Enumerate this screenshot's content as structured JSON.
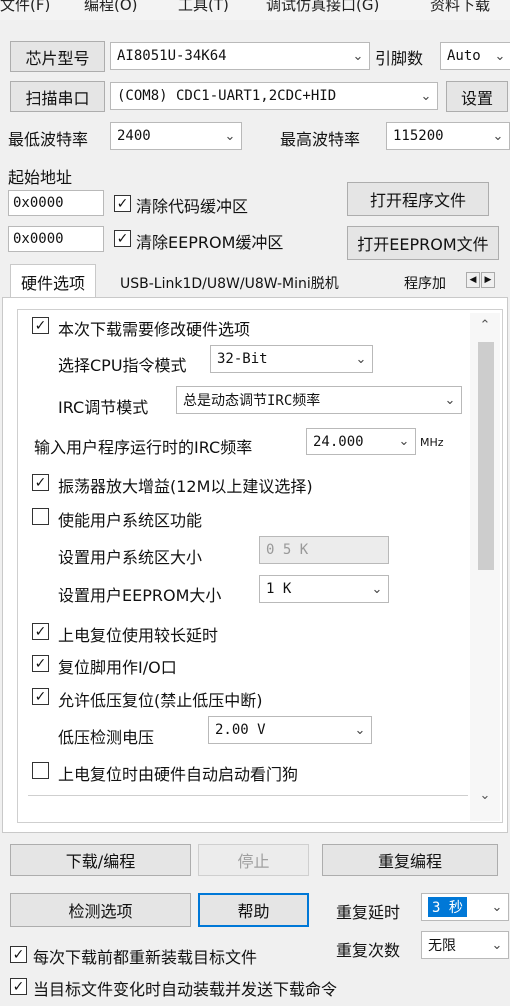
{
  "menu": [
    "文件(F)",
    "编程(O)",
    "工具(T)",
    "调试仿真接口(G)",
    "资料下载"
  ],
  "chip": {
    "button": "芯片型号",
    "value": "AI8051U-34K64",
    "pins_label": "引脚数",
    "pins_value": "Auto"
  },
  "port": {
    "button": "扫描串口",
    "value": "(COM8) CDC1-UART1,2CDC+HID",
    "settings_button": "设置"
  },
  "baud": {
    "min_label": "最低波特率",
    "min_value": "2400",
    "max_label": "最高波特率",
    "max_value": "115200"
  },
  "start_address": {
    "label": "起始地址",
    "code_address": "0x0000",
    "clear_code_label": "清除代码缓冲区",
    "open_program_button": "打开程序文件",
    "eeprom_address": "0x0000",
    "clear_eeprom_label": "清除EEPROM缓冲区",
    "open_eeprom_button": "打开EEPROM文件"
  },
  "tabs": [
    {
      "label": "硬件选项"
    },
    {
      "label": "USB-Link1D/U8W/U8W-Mini脱机"
    },
    {
      "label": "程序加"
    }
  ],
  "hardware": {
    "modify_options": {
      "label": "本次下载需要修改硬件选项",
      "checked": true
    },
    "cpu_mode": {
      "label": "选择CPU指令模式",
      "value": "32-Bit"
    },
    "irc_mode": {
      "label": "IRC调节模式",
      "value": "总是动态调节IRC频率"
    },
    "irc_freq": {
      "label": "输入用户程序运行时的IRC频率",
      "value": "24.000",
      "unit": "MHz"
    },
    "osc_gain": {
      "label": "振荡器放大增益(12M以上建议选择)",
      "checked": true
    },
    "user_sys_area": {
      "label": "使能用户系统区功能",
      "checked": false
    },
    "user_sys_size": {
      "label": "设置用户系统区大小",
      "value": "0 5 K"
    },
    "user_eeprom_size": {
      "label": "设置用户EEPROM大小",
      "value": "1   K"
    },
    "long_reset_delay": {
      "label": "上电复位使用较长延时",
      "checked": true
    },
    "reset_pin_io": {
      "label": "复位脚用作I/O口",
      "checked": true
    },
    "low_voltage_reset": {
      "label": "允许低压复位(禁止低压中断)",
      "checked": true
    },
    "lv_detect": {
      "label": "低压检测电压",
      "value": "2.00 V"
    },
    "auto_watchdog": {
      "label": "上电复位时由硬件自动启动看门狗",
      "checked": false
    }
  },
  "bottom": {
    "download_button": "下载/编程",
    "stop_button": "停止",
    "repeat_button": "重复编程",
    "detect_button": "检测选项",
    "help_button": "帮助",
    "repeat_delay_label": "重复延时",
    "repeat_delay_value": "3 秒",
    "repeat_count_label": "重复次数",
    "repeat_count_value": "无限",
    "reload_before_download": {
      "label": "每次下载前都重新装载目标文件",
      "checked": true
    },
    "auto_load_on_change": {
      "label": "当目标文件变化时自动装载并发送下载命令",
      "checked": true
    }
  }
}
